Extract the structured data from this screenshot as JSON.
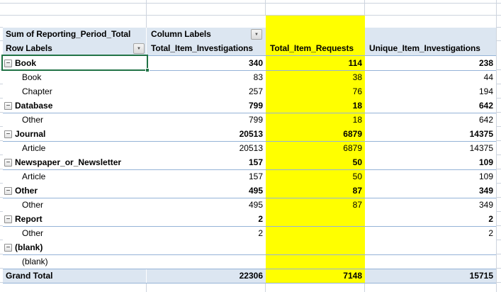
{
  "icons": {
    "collapse_minus": "−",
    "filter_dropdown": "▼"
  },
  "colors": {
    "header_fill": "#DCE6F1",
    "grand_total_fill": "#DCE6F1",
    "highlight_column": "#FFFF00",
    "pivot_border": "#95B3D7",
    "gridline": "#CDD4DE",
    "selection_green": "#217346"
  },
  "pivot": {
    "value_field_label": "Sum of Reporting_Period_Total",
    "column_labels_label": "Column Labels",
    "row_labels_label": "Row Labels",
    "column_headers": [
      "Total_Item_Investigations",
      "Total_Item_Requests",
      "Unique_Item_Investigations"
    ],
    "rows": [
      {
        "label": "Book",
        "type": "category",
        "values": [
          "340",
          "114",
          "238"
        ]
      },
      {
        "label": "Book",
        "type": "child",
        "values": [
          "83",
          "38",
          "44"
        ]
      },
      {
        "label": "Chapter",
        "type": "child",
        "values": [
          "257",
          "76",
          "194"
        ]
      },
      {
        "label": "Database",
        "type": "category",
        "values": [
          "799",
          "18",
          "642"
        ]
      },
      {
        "label": "Other",
        "type": "child",
        "values": [
          "799",
          "18",
          "642"
        ]
      },
      {
        "label": "Journal",
        "type": "category",
        "values": [
          "20513",
          "6879",
          "14375"
        ]
      },
      {
        "label": "Article",
        "type": "child",
        "values": [
          "20513",
          "6879",
          "14375"
        ]
      },
      {
        "label": "Newspaper_or_Newsletter",
        "type": "category",
        "values": [
          "157",
          "50",
          "109"
        ]
      },
      {
        "label": "Article",
        "type": "child",
        "values": [
          "157",
          "50",
          "109"
        ]
      },
      {
        "label": "Other",
        "type": "category",
        "values": [
          "495",
          "87",
          "349"
        ]
      },
      {
        "label": "Other",
        "type": "child",
        "values": [
          "495",
          "87",
          "349"
        ]
      },
      {
        "label": "Report",
        "type": "category",
        "values": [
          "2",
          "",
          "2"
        ]
      },
      {
        "label": "Other",
        "type": "child",
        "values": [
          "2",
          "",
          "2"
        ]
      },
      {
        "label": "(blank)",
        "type": "category",
        "values": [
          "",
          "",
          ""
        ]
      },
      {
        "label": "(blank)",
        "type": "child",
        "values": [
          "",
          "",
          ""
        ]
      },
      {
        "label": "Grand Total",
        "type": "grand",
        "values": [
          "22306",
          "7148",
          "15715"
        ]
      }
    ]
  }
}
